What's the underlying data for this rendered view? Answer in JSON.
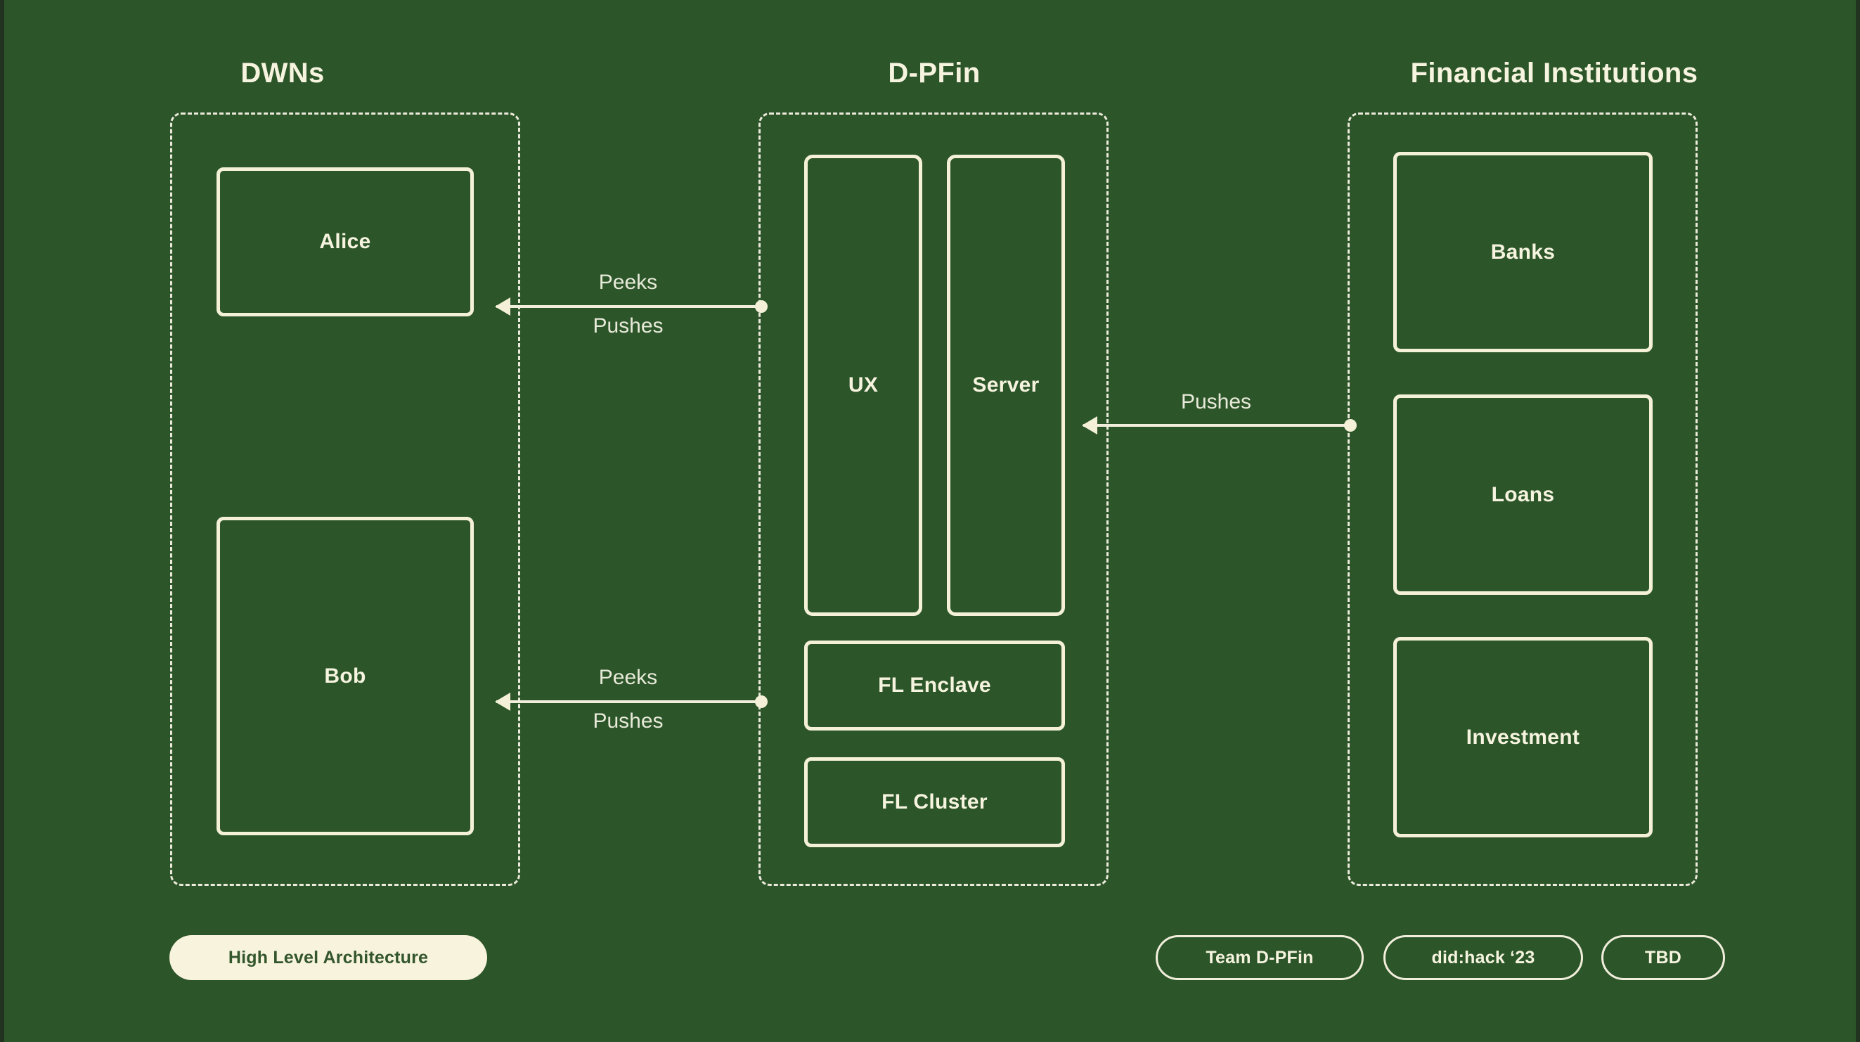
{
  "theme": {
    "background": "#2c5529",
    "ink": "#f6f4df",
    "line": "#f1eedc",
    "pill_fill": "#f8f3dd",
    "pill_fill_text": "#33562d"
  },
  "columns": [
    {
      "title": "DWNs"
    },
    {
      "title": "D-PFin"
    },
    {
      "title": "Financial Institutions"
    }
  ],
  "dwns": {
    "nodes": [
      {
        "label": "Alice"
      },
      {
        "label": "Bob"
      }
    ]
  },
  "dpfin": {
    "nodes": [
      {
        "label": "UX"
      },
      {
        "label": "Server"
      },
      {
        "label": "FL Enclave"
      },
      {
        "label": "FL Cluster"
      }
    ]
  },
  "institutions": {
    "nodes": [
      {
        "label": "Banks"
      },
      {
        "label": "Loans"
      },
      {
        "label": "Investment"
      }
    ]
  },
  "connectors": [
    {
      "id": "dpfin-to-alice",
      "above": "Peeks",
      "below": "Pushes",
      "direction": "left"
    },
    {
      "id": "dpfin-to-bob",
      "above": "Peeks",
      "below": "Pushes",
      "direction": "left"
    },
    {
      "id": "institutions-to-dpfin",
      "above": "Pushes",
      "below": "",
      "direction": "left"
    }
  ],
  "footer": {
    "title_pill": "High Level Architecture",
    "meta_pills": [
      "Team D-PFin",
      "did:hack ‘23",
      "TBD"
    ]
  }
}
